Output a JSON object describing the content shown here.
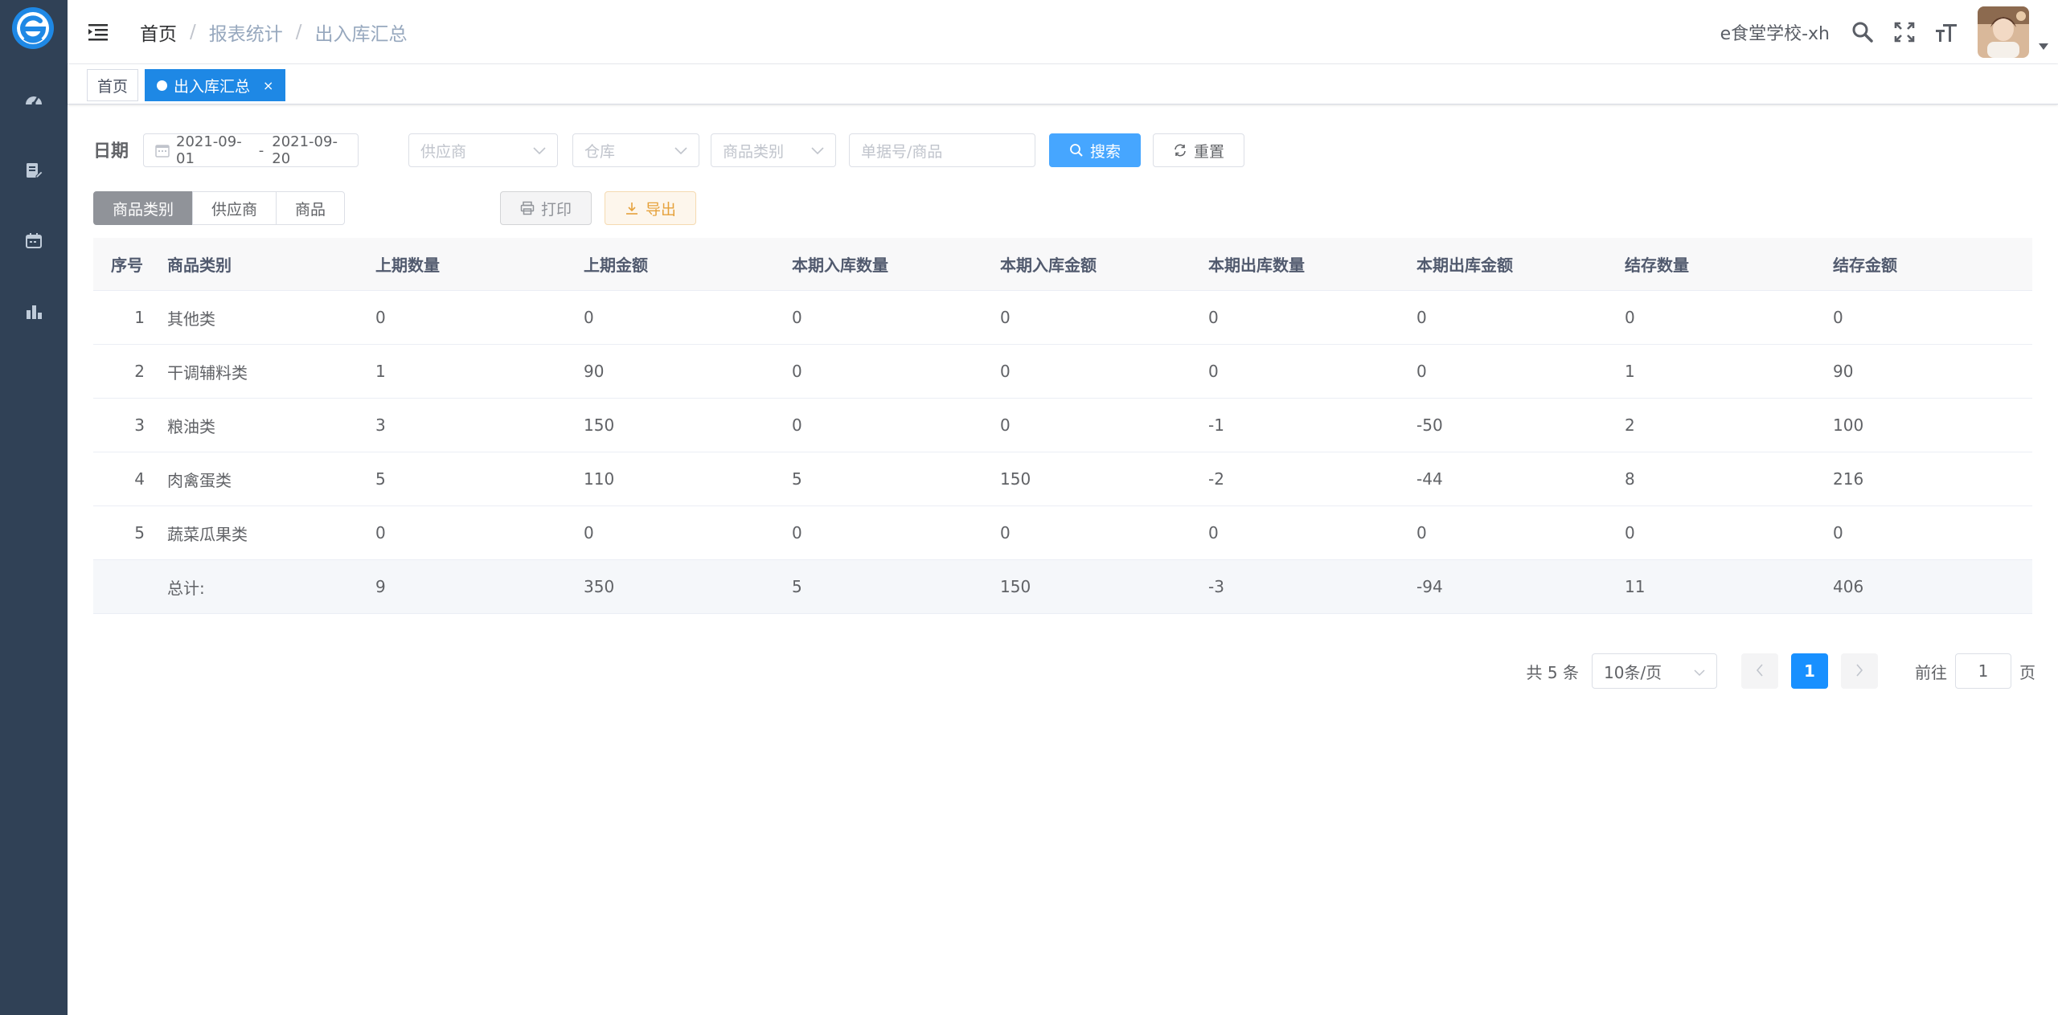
{
  "colors": {
    "sidebar_bg": "#304156",
    "primary": "#1890ff",
    "tag_active": "#1e88e5"
  },
  "breadcrumb": [
    "首页",
    "报表统计",
    "出入库汇总"
  ],
  "breadcrumb_separator": "/",
  "navbar": {
    "school_name": "e食堂学校-xh"
  },
  "tags": [
    {
      "label": "首页"
    },
    {
      "label": "出入库汇总",
      "close": "×"
    }
  ],
  "filters": {
    "date_label": "日期",
    "date_start": "2021-09-01",
    "date_separator": "-",
    "date_end": "2021-09-20",
    "supplier_placeholder": "供应商",
    "warehouse_placeholder": "仓库",
    "category_placeholder": "商品类别",
    "keyword_placeholder": "单据号/商品",
    "search_label": "搜索",
    "reset_label": "重置"
  },
  "view_tabs": [
    "商品类别",
    "供应商",
    "商品"
  ],
  "actions": {
    "print_label": "打印",
    "export_label": "导出"
  },
  "table": {
    "headers": [
      "序号",
      "商品类别",
      "上期数量",
      "上期金额",
      "本期入库数量",
      "本期入库金额",
      "本期出库数量",
      "本期出库金额",
      "结存数量",
      "结存金额"
    ],
    "rows": [
      [
        "1",
        "其他类",
        "0",
        "0",
        "0",
        "0",
        "0",
        "0",
        "0",
        "0"
      ],
      [
        "2",
        "干调辅料类",
        "1",
        "90",
        "0",
        "0",
        "0",
        "0",
        "1",
        "90"
      ],
      [
        "3",
        "粮油类",
        "3",
        "150",
        "0",
        "0",
        "-1",
        "-50",
        "2",
        "100"
      ],
      [
        "4",
        "肉禽蛋类",
        "5",
        "110",
        "5",
        "150",
        "-2",
        "-44",
        "8",
        "216"
      ],
      [
        "5",
        "蔬菜瓜果类",
        "0",
        "0",
        "0",
        "0",
        "0",
        "0",
        "0",
        "0"
      ]
    ],
    "total": [
      "",
      "总计:",
      "9",
      "350",
      "5",
      "150",
      "-3",
      "-94",
      "11",
      "406"
    ]
  },
  "pagination": {
    "total_text": "共 5 条",
    "page_size": "10条/页",
    "current_page": "1",
    "goto_label": "前往",
    "goto_value": "1",
    "page_suffix": "页"
  }
}
